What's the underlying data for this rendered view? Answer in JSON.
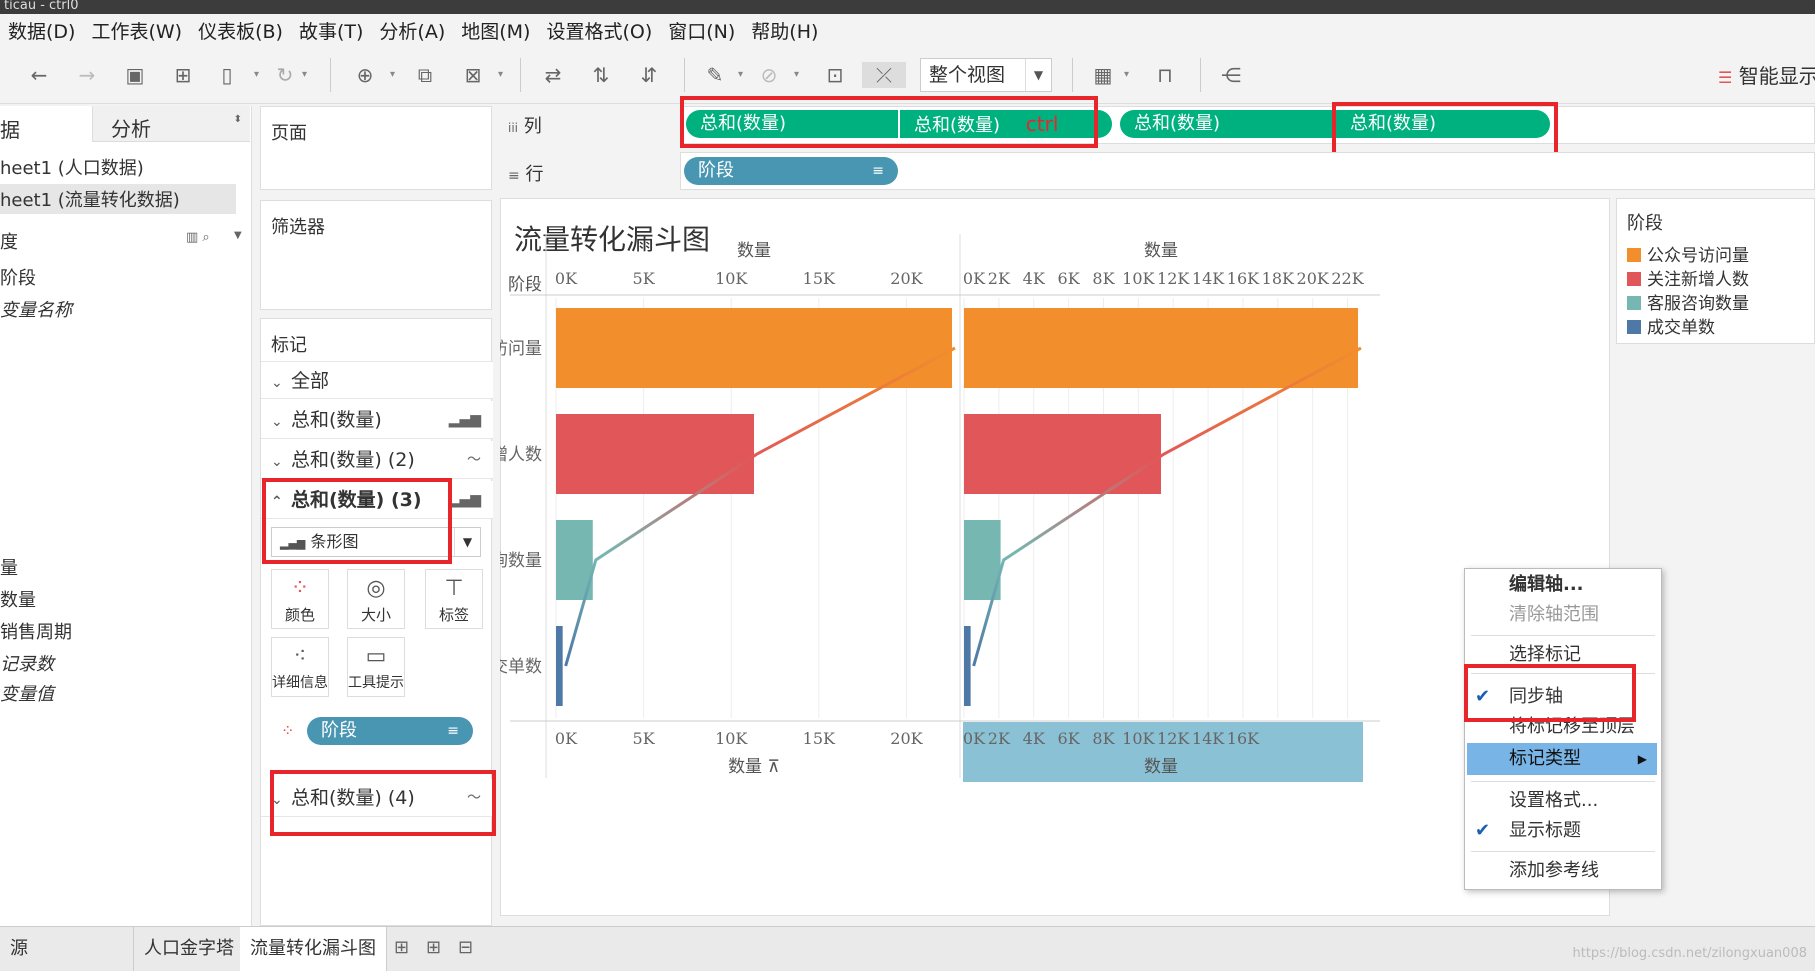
{
  "window": {
    "title": "ticau - ctrl0"
  },
  "menubar": [
    "数据(D)",
    "工作表(W)",
    "仪表板(B)",
    "故事(T)",
    "分析(A)",
    "地图(M)",
    "设置格式(O)",
    "窗口(N)",
    "帮助(H)"
  ],
  "toolbar": {
    "view_select": "整个视图",
    "smart_show": "智能显示",
    "icons": [
      "back-icon",
      "forward-icon",
      "save-icon",
      "new-datasource-icon",
      "pause-icon",
      "refresh-icon",
      "new-sheet-icon",
      "duplicate-icon",
      "clear-sheet-icon",
      "swap-icon",
      "sort-asc-icon",
      "sort-desc-icon",
      "highlight-icon",
      "group-icon",
      "label-icon",
      "fix-axes-icon",
      "show-me-icon",
      "presentation-icon",
      "share-icon"
    ]
  },
  "data_pane": {
    "tab_data": "据",
    "tab_analysis": "分析",
    "datasources": [
      "heet1 (人口数据)",
      "heet1 (流量转化数据)"
    ],
    "dimensions_header": "度",
    "dimensions": [
      "阶段",
      "变量名称"
    ],
    "measures_header": "量",
    "measures": [
      "数量",
      "销售周期",
      "记录数",
      "变量值"
    ]
  },
  "shelves": {
    "pages": "页面",
    "filters": "筛选器",
    "marks": "标记",
    "columns_label": "列",
    "rows_label": "行",
    "columns_pills": [
      "总和(数量)",
      "总和(数量)",
      "总和(数量)",
      "总和(数量)"
    ],
    "ctrl_annotation": "ctrl",
    "rows_pill": "阶段"
  },
  "marks_card": {
    "all": "全部",
    "layers": [
      "总和(数量)",
      "总和(数量) (2)",
      "总和(数量) (3)",
      "总和(数量) (4)"
    ],
    "mark_type": "条形图",
    "buttons": [
      "颜色",
      "大小",
      "标签",
      "详细信息",
      "工具提示"
    ],
    "color_pill": "阶段"
  },
  "sheet": {
    "title": "流量转化漏斗图"
  },
  "chart_data": {
    "type": "bar",
    "categories": [
      "公众号访问量",
      "关注新增人数",
      "客服咨询数量",
      "成交单数"
    ],
    "values": [
      22600,
      11300,
      2100,
      380
    ],
    "colors": [
      "#f28e2b",
      "#e15759",
      "#76b7b2",
      "#4e79a7"
    ],
    "row_header": "阶段",
    "left_axis": {
      "title": "数量",
      "ticks": [
        "0K",
        "5K",
        "10K",
        "15K",
        "20K"
      ],
      "ylim": [
        0,
        22600
      ]
    },
    "right_axis": {
      "title": "数量",
      "ticks": [
        "0K",
        "2K",
        "4K",
        "6K",
        "8K",
        "10K",
        "12K",
        "14K",
        "16K",
        "18K",
        "20K",
        "22K"
      ],
      "ylim": [
        0,
        22600
      ]
    },
    "bottom_left_ticks": [
      "0K",
      "5K",
      "10K",
      "15K",
      "20K"
    ],
    "bottom_right_ticks": [
      "0K",
      "2K",
      "4K",
      "6K",
      "8K",
      "10K",
      "12K",
      "14K",
      "16K"
    ],
    "bottom_left_title": "数量",
    "bottom_right_title": "数量"
  },
  "legend": {
    "title": "阶段",
    "items": [
      {
        "label": "公众号访问量",
        "color": "#f28e2b"
      },
      {
        "label": "关注新增人数",
        "color": "#e15759"
      },
      {
        "label": "客服咨询数量",
        "color": "#76b7b2"
      },
      {
        "label": "成交单数",
        "color": "#4e79a7"
      }
    ]
  },
  "context_menu": {
    "edit_axis": "编辑轴...",
    "clear_axis_range": "清除轴范围",
    "select_marks": "选择标记",
    "sync_axis": "同步轴",
    "move_marks_top": "将标记移至顶层",
    "mark_type": "标记类型",
    "format": "设置格式...",
    "show_header": "显示标题",
    "add_reference_line": "添加参考线"
  },
  "bottom_tabs": [
    "源",
    "人口金字塔",
    "流量转化漏斗图"
  ],
  "watermark": "https://blog.csdn.net/zilongxuan008"
}
